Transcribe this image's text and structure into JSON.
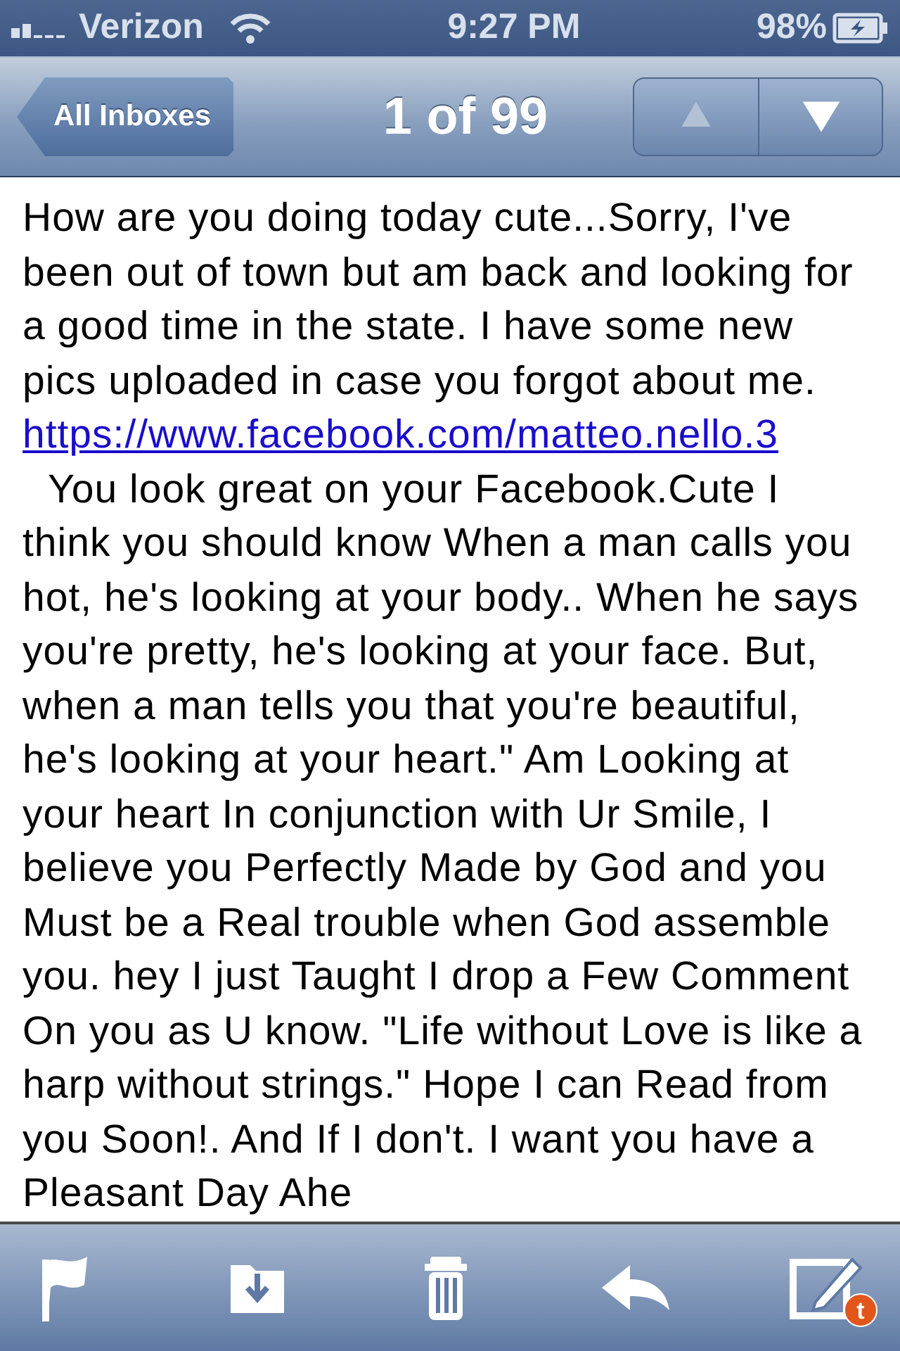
{
  "status_bar": {
    "carrier": "Verizon",
    "time": "9:27 PM",
    "battery": "98%"
  },
  "nav_bar": {
    "back": "All Inboxes",
    "title": "1 of 99",
    "buttons": [
      {
        "kind": "up",
        "disabled": true
      },
      {
        "kind": "down",
        "disabled": false
      }
    ]
  },
  "message": {
    "intro": "How are you doing today cute...Sorry, I've been out of town but am back and looking for a good time in the state. I have some new pics uploaded in case you forgot about me.",
    "link": "https://www.facebook.com/matteo.nello.3",
    "text": "You look great on your Facebook.Cute I think you should know When a man calls you hot, he's looking at your body.. When he says you're pretty, he's looking at your face. But, when a man tells you that you're beautiful, he's looking at your heart.\" Am Looking at your heart In conjunction with Ur Smile, I believe you Perfectly Made by God and you Must be a Real trouble when God assemble you. hey I just Taught I drop a Few Comment On you as U know. \"Life without Love is like a harp without strings.\" Hope I can Read from you Soon!. And If I don't. I want you have a Pleasant Day Ahe"
  },
  "toolbar": [
    {
      "kind": "flag"
    },
    {
      "kind": "move"
    },
    {
      "kind": "trash"
    },
    {
      "kind": "reply"
    },
    {
      "kind": "compose",
      "badge": "t"
    }
  ]
}
